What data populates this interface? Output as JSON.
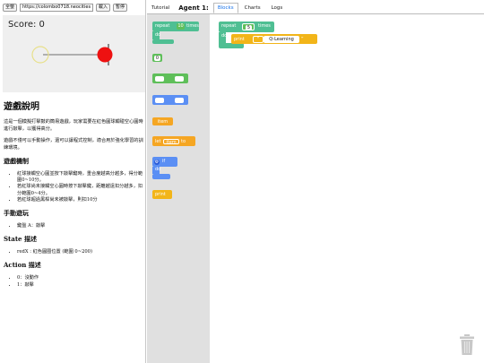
{
  "topbar": {
    "fullscreen_label": "全螢",
    "url_value": "https://colombo0718.neocities.org/p",
    "load_label": "載入",
    "pause_label": "暫停"
  },
  "game": {
    "score_text": "Score: 0"
  },
  "doc": {
    "title": "遊戲說明",
    "intro": "這是一個模擬打擊鼓的簡易遊戲，玩家需要在紅色圓球觸碰空心圓時進行敲擊，以獲得高分。",
    "intro2": "遊戲不僅可以手動操作，還可以讓程式控制，適合用於強化學習的訓練環境。",
    "mechanics_title": "遊戲機制",
    "mechanics": [
      "紅球接觸空心圓並按下敲擊鍵時，重合度越高分越多，得分範圍0~10分。",
      "若紅球尚未接觸空心圓時按下敲擊鍵，距離越遠扣分越多，扣分範圍0~4分。",
      "若紅球超過黑桿尚未被敲擊，則扣10分"
    ],
    "manual_title": "手動遊玩",
    "manual": [
      "鍵盤 A：敲擊"
    ],
    "state_title": "State 描述",
    "state": [
      "redX : 紅色圓圈位置 (範圍 0~200)"
    ],
    "action_title": "Action 描述",
    "action": [
      "0：沒動作",
      "1：敲擊"
    ]
  },
  "tabs": {
    "tutorial": "Tutorial",
    "agent": "Agent 1:",
    "blocks": "Blocks",
    "charts": "Charts",
    "logs": "Logs"
  },
  "flyout": {
    "repeat_label": "repeat",
    "repeat_count": "10",
    "times_label": "times",
    "do_label": "do",
    "number_value": "0",
    "item_label": "item",
    "let_label": "let",
    "to_label": "to",
    "if_label": "if",
    "print_label": "print"
  },
  "workspace": {
    "repeat_label": "repeat",
    "repeat_count": "5",
    "times_label": "times",
    "do_label": "do",
    "print_label": "print",
    "print_value": "Q-Learning"
  },
  "colors": {
    "loop_green": "#4fbf93",
    "math_green": "#5fbf5a",
    "variable_orange": "#f5a623",
    "logic_blue": "#5b8ff4",
    "text_yellow": "#f2b519"
  }
}
